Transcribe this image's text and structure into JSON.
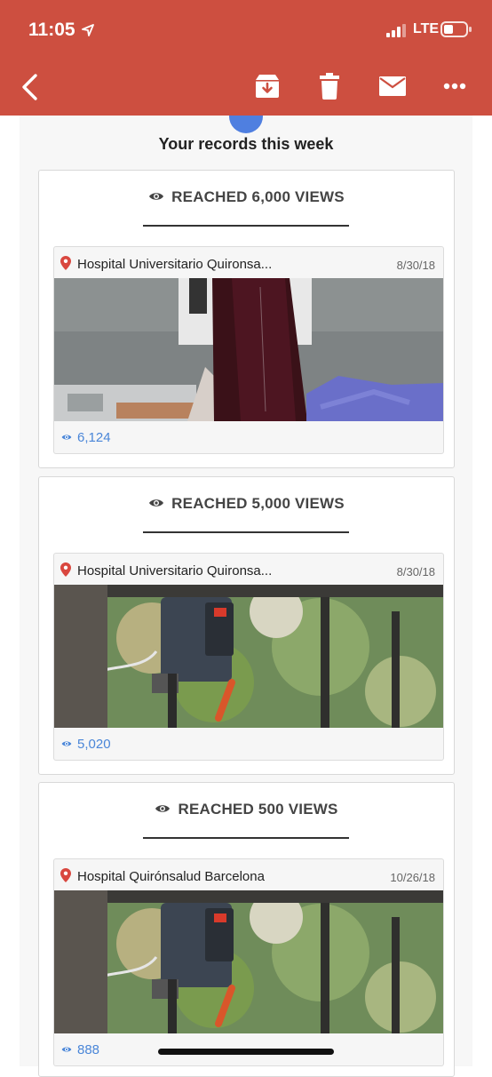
{
  "status_bar": {
    "time": "11:05",
    "network": "LTE"
  },
  "toolbar": {
    "icons": [
      "back-icon",
      "archive-icon",
      "trash-icon",
      "mail-icon",
      "more-icon"
    ],
    "accent_color": "#cd4f40"
  },
  "page": {
    "title": "Your records this week"
  },
  "records": [
    {
      "heading": "REACHED 6,000 VIEWS",
      "post": {
        "location": "Hospital Universitario Quironsa...",
        "date": "8/30/18",
        "views": "6,124"
      }
    },
    {
      "heading": "REACHED 5,000 VIEWS",
      "post": {
        "location": "Hospital Universitario Quironsa...",
        "date": "8/30/18",
        "views": "5,020"
      }
    },
    {
      "heading": "REACHED 500 VIEWS",
      "post": {
        "location": "Hospital Quirónsalud Barcelona",
        "date": "10/26/18",
        "views": "888"
      }
    }
  ],
  "colors": {
    "views_link": "#4a86d8",
    "pin": "#d9473f"
  }
}
